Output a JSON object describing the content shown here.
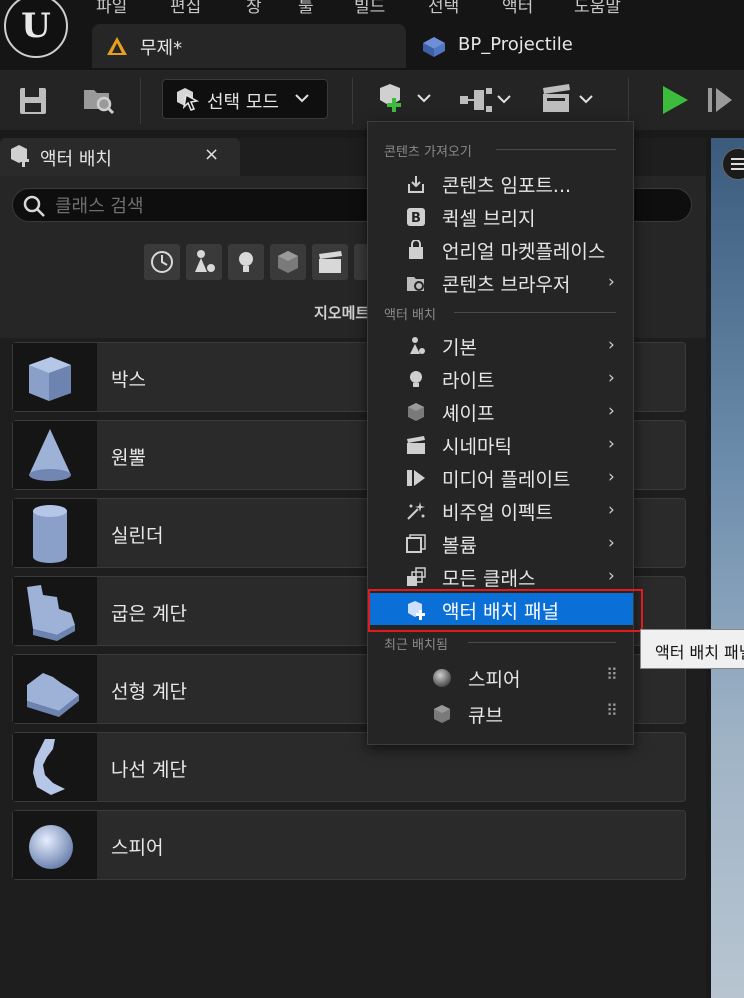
{
  "menubar": {
    "items": [
      "파일",
      "편집",
      "창",
      "툴",
      "빌드",
      "선택",
      "액터",
      "도움말"
    ]
  },
  "logo": {
    "glyph": "U"
  },
  "doc_tabs": [
    {
      "label": "무제*",
      "active": true
    },
    {
      "label": "BP_Projectile",
      "active": false
    }
  ],
  "toolbar": {
    "mode_label": "선택 모드"
  },
  "panel": {
    "title": "액터 배치",
    "close_glyph": "×",
    "search_placeholder": "클래스 검색",
    "category_label": "지오메트",
    "items": [
      "박스",
      "원뿔",
      "실린더",
      "굽은 계단",
      "선형 계단",
      "나선 계단",
      "스피어"
    ]
  },
  "dropdown": {
    "section_import": "콘텐츠 가져오기",
    "import_items": [
      "콘텐츠 임포트...",
      "퀵셀 브리지",
      "언리얼 마켓플레이스",
      "콘텐츠 브라우저"
    ],
    "section_place": "액터 배치",
    "place_items": [
      "기본",
      "라이트",
      "셰이프",
      "시네마틱",
      "미디어 플레이트",
      "비주얼 이펙트",
      "볼륨",
      "모든 클래스"
    ],
    "highlighted_item": "액터 배치 패널",
    "section_recent": "최근 배치됨",
    "recent_items": [
      "스피어",
      "큐브"
    ],
    "chevron": "›",
    "grip": "⠿"
  },
  "tooltip": {
    "text": "액터 배치 패널"
  },
  "colors": {
    "accent": "#0a6fd6",
    "highlight_border": "#e01b1b",
    "play_green": "#3dbb3d"
  }
}
